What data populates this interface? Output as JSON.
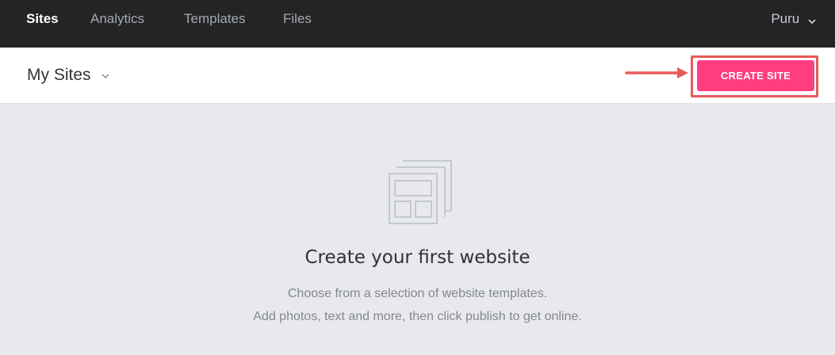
{
  "nav": {
    "items": [
      {
        "label": "Sites",
        "active": true
      },
      {
        "label": "Analytics",
        "active": false
      },
      {
        "label": "Templates",
        "active": false
      },
      {
        "label": "Files",
        "active": false
      }
    ],
    "user": {
      "label": "Puru",
      "icon": "chevron-down-icon"
    }
  },
  "subheader": {
    "title": "My Sites",
    "title_icon": "chevron-down-icon",
    "create_button": "CREATE SITE"
  },
  "empty_state": {
    "icon": "website-template-icon",
    "title": "Create your first website",
    "line1": "Choose from a selection of website templates.",
    "line2": "Add photos, text and more, then click publish to get online."
  },
  "colors": {
    "topbar_bg": "#222426",
    "accent": "#ff3d7f",
    "annotation": "#e85a5a",
    "page_bg": "#e7e9ec"
  }
}
